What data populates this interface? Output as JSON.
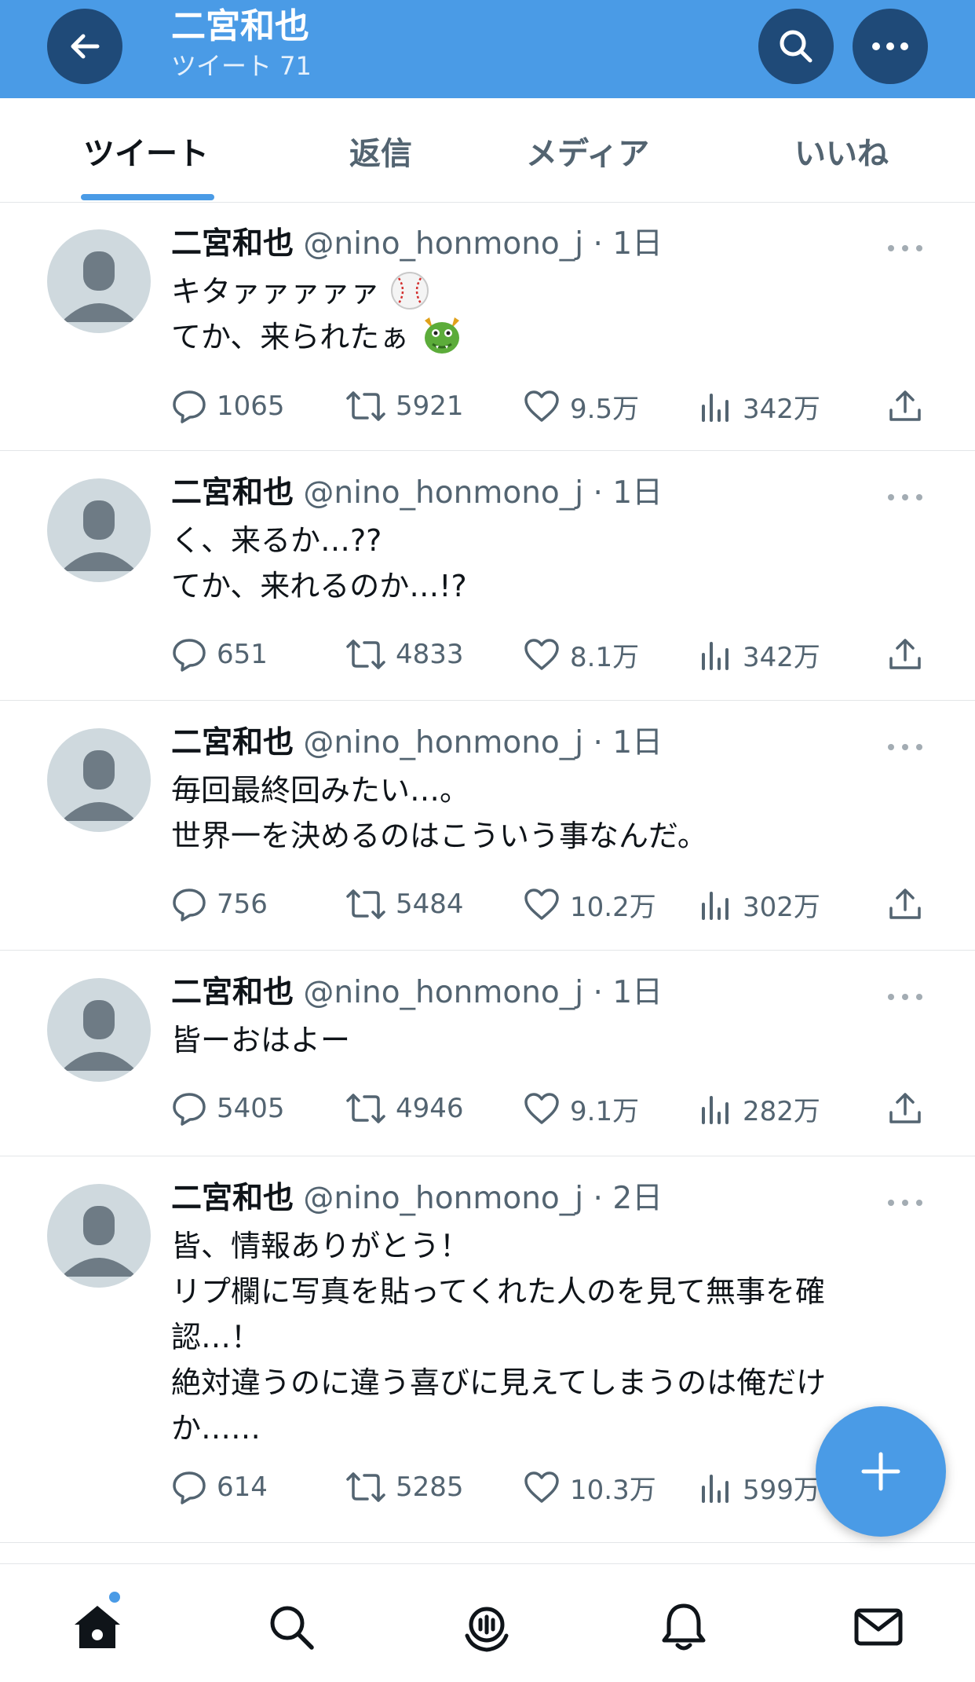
{
  "header": {
    "title": "二宮和也",
    "subtitle": "ツイート 71",
    "back_icon": "arrow-left-icon",
    "search_icon": "search-icon",
    "more_icon": "more-icon",
    "background_color": "#4a9be6",
    "button_color": "#1f4a78"
  },
  "tabs": [
    {
      "label": "ツイート",
      "active": true
    },
    {
      "label": "返信",
      "active": false
    },
    {
      "label": "メディア",
      "active": false
    },
    {
      "label": "いいね",
      "active": false
    }
  ],
  "tweets": [
    {
      "name": "二宮和也",
      "handle": "@nino_honmono_j",
      "dot": "·",
      "time": "1日",
      "line1": "キタァァァァァ",
      "line1_emoji": "baseball-emoji",
      "line2": "てか、来られたぁ",
      "line2_emoji": "dragon-face-emoji",
      "replies": "1065",
      "retweets": "5921",
      "likes": "9.5万",
      "views": "342万"
    },
    {
      "name": "二宮和也",
      "handle": "@nino_honmono_j",
      "dot": "·",
      "time": "1日",
      "text": "く、来るか…??\nてか、来れるのか…!?",
      "replies": "651",
      "retweets": "4833",
      "likes": "8.1万",
      "views": "342万"
    },
    {
      "name": "二宮和也",
      "handle": "@nino_honmono_j",
      "dot": "·",
      "time": "1日",
      "text": "毎回最終回みたい…。\n世界一を決めるのはこういう事なんだ。",
      "replies": "756",
      "retweets": "5484",
      "likes": "10.2万",
      "views": "302万"
    },
    {
      "name": "二宮和也",
      "handle": "@nino_honmono_j",
      "dot": "·",
      "time": "1日",
      "text": "皆ーおはよー",
      "replies": "5405",
      "retweets": "4946",
      "likes": "9.1万",
      "views": "282万"
    },
    {
      "name": "二宮和也",
      "handle": "@nino_honmono_j",
      "dot": "·",
      "time": "2日",
      "text": "皆、情報ありがとう！\nリプ欄に写真を貼ってくれた人のを見て無事を確\n認…！\n絶対違うのに違う喜びに見えてしまうのは俺だけ\nか……",
      "replies": "614",
      "retweets": "5285",
      "likes": "10.3万",
      "views": "599万"
    }
  ],
  "fab": {
    "icon": "plus-icon",
    "color": "#4a9be6"
  },
  "bottom_nav": [
    {
      "icon": "home-icon",
      "active": true,
      "badge": true
    },
    {
      "icon": "search-icon",
      "active": false
    },
    {
      "icon": "spaces-icon",
      "active": false
    },
    {
      "icon": "bell-icon",
      "active": false
    },
    {
      "icon": "mail-icon",
      "active": false
    }
  ]
}
